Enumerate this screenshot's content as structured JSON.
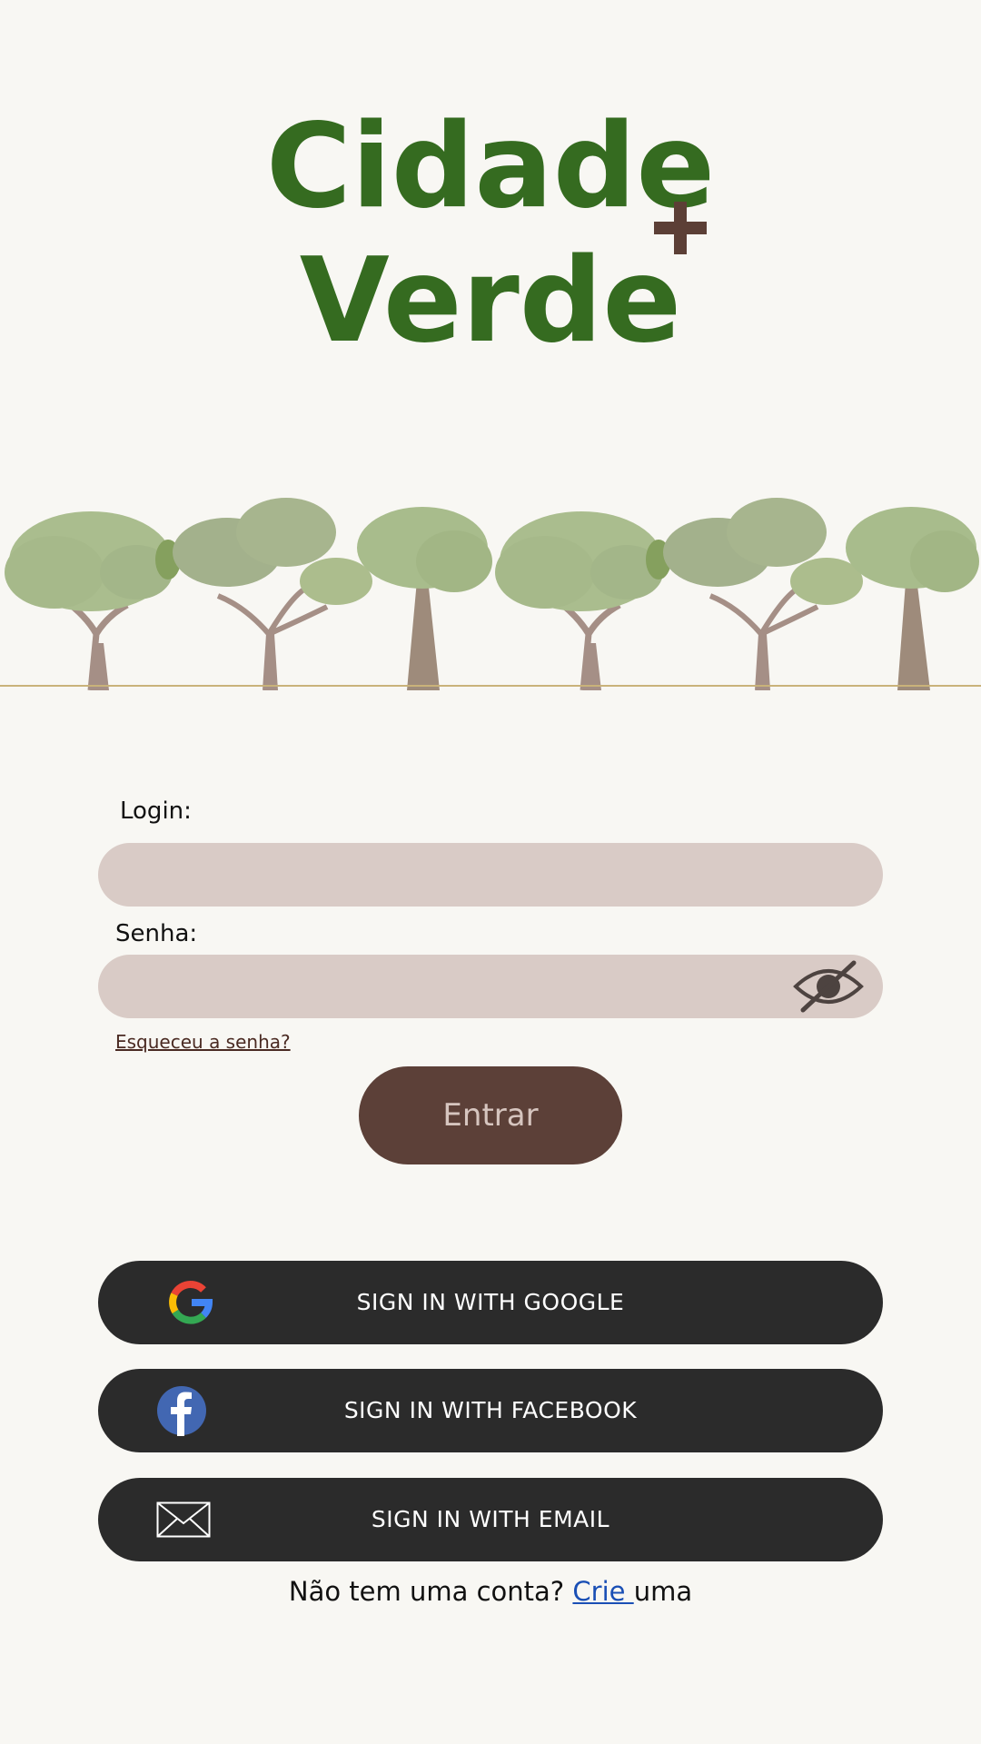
{
  "logo": {
    "line1": "Cidade",
    "line2": "Verde",
    "plus_symbol": "+"
  },
  "form": {
    "login_label": "Login:",
    "login_value": "",
    "password_label": "Senha:",
    "password_value": "",
    "forgot_password": "Esqueceu a senha?",
    "submit_label": "Entrar"
  },
  "social": {
    "google": {
      "label": "SIGN IN WITH GOOGLE",
      "icon": "google-icon"
    },
    "facebook": {
      "label": "SIGN IN WITH FACEBOOK",
      "icon": "facebook-icon"
    },
    "email": {
      "label": "SIGN IN WITH EMAIL",
      "icon": "envelope-icon"
    }
  },
  "signup": {
    "prefix": "Não tem uma conta? ",
    "link": "Crie ",
    "suffix": "uma"
  },
  "colors": {
    "background": "#f8f7f3",
    "brand_green": "#356b20",
    "brand_brown": "#5c4038",
    "input_bg": "#d9cbc6",
    "social_bg": "#2b2b2b",
    "link_blue": "#1a4fb5"
  }
}
